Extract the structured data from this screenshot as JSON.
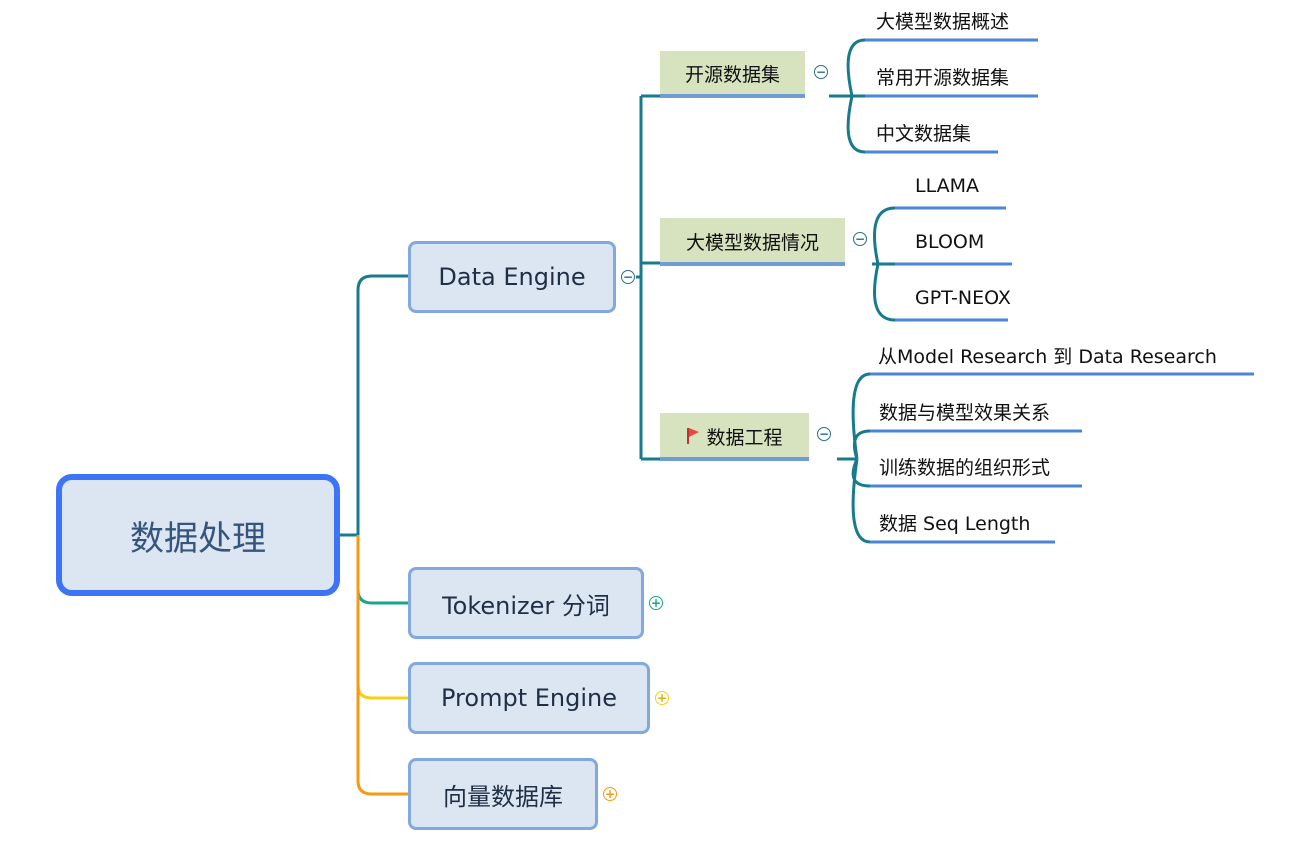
{
  "root": {
    "label": "数据处理"
  },
  "branches": [
    {
      "label": "Data Engine",
      "toggle": "−"
    },
    {
      "label": "Tokenizer 分词",
      "toggle": "+"
    },
    {
      "label": "Prompt Engine",
      "toggle": "+"
    },
    {
      "label": "向量数据库",
      "toggle": "+"
    }
  ],
  "data_engine_children": [
    {
      "label": "开源数据集",
      "toggle": "−",
      "children": [
        "大模型数据概述",
        "常用开源数据集",
        "中文数据集"
      ]
    },
    {
      "label": "大模型数据情况",
      "toggle": "−",
      "children": [
        "LLAMA",
        "BLOOM",
        "GPT-NEOX"
      ]
    },
    {
      "label": "数据工程",
      "toggle": "−",
      "icon": "red-flag-icon",
      "children": [
        "从Model Research 到 Data Research",
        "数据与模型效果关系",
        "训练数据的组织形式",
        "数据 Seq Length"
      ]
    }
  ],
  "colors": {
    "root_border": "#3d74f5",
    "node_fill": "#dce6f2",
    "node_border": "#82a8e0",
    "subtopic_fill": "#d6e3be",
    "leaf_underline": "#4a86d8",
    "branch_data_engine": "#187a8c",
    "branch_tokenizer": "#1aa58a",
    "branch_prompt": "#f5d10f",
    "branch_vector_db": "#f59a12",
    "flag": "#e8493e"
  }
}
